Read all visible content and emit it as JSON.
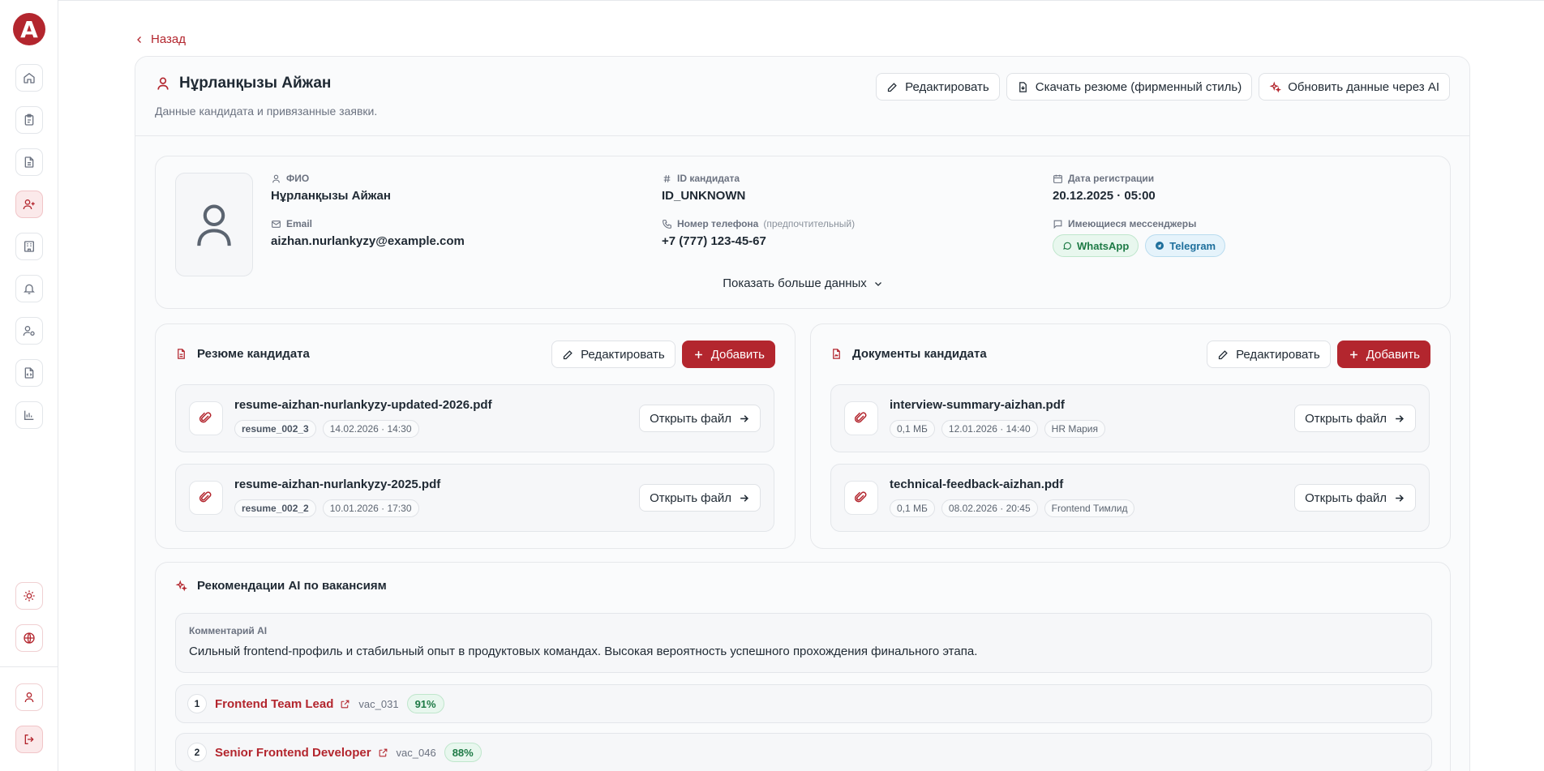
{
  "sidebar": {
    "logo": "A",
    "icons": [
      "home-icon",
      "clipboard-icon",
      "file-text-icon",
      "user-plus-icon",
      "building-icon",
      "bell-icon",
      "user-gear-icon",
      "file-code-icon",
      "bar-chart-icon"
    ],
    "bottom_icons": [
      "sun-icon",
      "globe-icon",
      "user-icon",
      "logout-icon"
    ]
  },
  "nav": {
    "back_label": "Назад"
  },
  "header": {
    "title": "Нұрланқызы Айжан",
    "subtitle": "Данные кандидата и привязанные заявки.",
    "edit_label": "Редактировать",
    "download_label": "Скачать резюме (фирменный стиль)",
    "ai_update_label": "Обновить данные через AI"
  },
  "profile": {
    "name_label": "ФИО",
    "name_value": "Нұрланқызы Айжан",
    "email_label": "Email",
    "email_value": "aizhan.nurlankyzy@example.com",
    "id_label": "ID кандидата",
    "id_value": "ID_UNKNOWN",
    "phone_label": "Номер телефона",
    "phone_hint": "(предпочтительный)",
    "phone_value": "+7 (777) 123-45-67",
    "reg_label": "Дата регистрации",
    "reg_value": "20.12.2025 · 05:00",
    "messengers_label": "Имеющиеся мессенджеры",
    "messengers": [
      "WhatsApp",
      "Telegram"
    ],
    "show_more_label": "Показать больше данных"
  },
  "resumes": {
    "title": "Резюме кандидата",
    "edit_label": "Редактировать",
    "add_label": "Добавить",
    "items": [
      {
        "name": "resume-aizhan-nurlankyzy-updated-2026.pdf",
        "tag_id": "resume_002_3",
        "date": "14.02.2026 · 14:30",
        "open_label": "Открыть файл"
      },
      {
        "name": "resume-aizhan-nurlankyzy-2025.pdf",
        "tag_id": "resume_002_2",
        "date": "10.01.2026 · 17:30",
        "open_label": "Открыть файл"
      }
    ]
  },
  "documents": {
    "title": "Документы кандидата",
    "edit_label": "Редактировать",
    "add_label": "Добавить",
    "items": [
      {
        "name": "interview-summary-aizhan.pdf",
        "size": "0,1 МБ",
        "date": "12.01.2026 · 14:40",
        "author": "HR Мария",
        "open_label": "Открыть файл"
      },
      {
        "name": "technical-feedback-aizhan.pdf",
        "size": "0,1 МБ",
        "date": "08.02.2026 · 20:45",
        "author": "Frontend Тимлид",
        "open_label": "Открыть файл"
      }
    ]
  },
  "recommendations": {
    "title": "Рекомендации AI по вакансиям",
    "comment_label": "Комментарий AI",
    "comment_text": "Сильный frontend-профиль и стабильный опыт в продуктовых командах. Высокая вероятность успешного прохождения финального этапа.",
    "vacancies": [
      {
        "rank": "1",
        "title": "Frontend Team Lead",
        "id": "vac_031",
        "score": "91%"
      },
      {
        "rank": "2",
        "title": "Senior Frontend Developer",
        "id": "vac_046",
        "score": "88%"
      }
    ]
  },
  "colors": {
    "accent": "#b3262e",
    "success": "#1d7a45",
    "telegram": "#1e6f9c"
  }
}
